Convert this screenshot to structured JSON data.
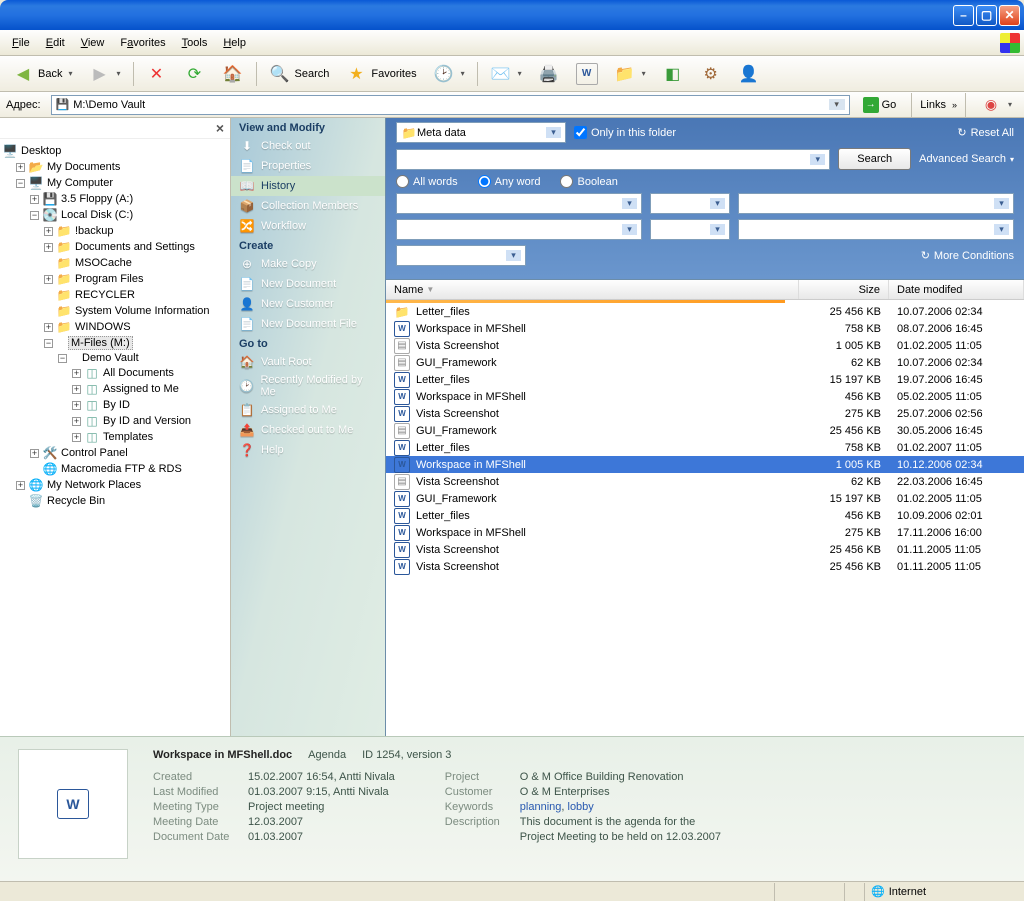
{
  "window": {
    "title_blank": ""
  },
  "menu": {
    "file": "File",
    "edit": "Edit",
    "view": "View",
    "favorites": "Favorites",
    "tools": "Tools",
    "help": "Help"
  },
  "toolbar": {
    "back": "Back",
    "search": "Search",
    "favorites": "Favorites"
  },
  "address": {
    "label": "Адрес:",
    "path": "M:\\Demo Vault",
    "go": "Go",
    "links": "Links"
  },
  "tree": {
    "desktop": "Desktop",
    "my_documents": "My Documents",
    "my_computer": "My Computer",
    "floppy": "3.5 Floppy (A:)",
    "local_disk": "Local Disk (C:)",
    "backup": "!backup",
    "docs_settings": "Documents and Settings",
    "msocache": "MSOCache",
    "program_files": "Program Files",
    "recycler": "RECYCLER",
    "svi": "System Volume Information",
    "windows": "WINDOWS",
    "mfiles": "M-Files (M:)",
    "demo_vault": "Demo Vault",
    "all_docs": "All Documents",
    "assigned": "Assigned to Me",
    "by_id": "By ID",
    "by_id_ver": "By ID and Version",
    "templates": "Templates",
    "control_panel": "Control Panel",
    "macromedia": "Macromedia FTP & RDS",
    "network_places": "My Network Places",
    "recycle_bin": "Recycle Bin"
  },
  "task": {
    "view_modify": "View and Modify",
    "check_out": "Check out",
    "properties": "Properties",
    "history": "History",
    "collection": "Collection Members",
    "workflow": "Workflow",
    "create": "Create",
    "make_copy": "Make Copy",
    "new_doc": "New Document",
    "new_cust": "New Customer",
    "new_doc_file": "New Document File",
    "go_to": "Go to",
    "vault_root": "Vault Root",
    "recently_mod": "Recently Modified by Me",
    "assigned_me": "Assigned to Me",
    "checked_out": "Checked out to Me",
    "help": "Help"
  },
  "search": {
    "meta_data": "Meta data",
    "only_folder": "Only in this folder",
    "reset_all": "Reset All",
    "search_btn": "Search",
    "advanced": "Advanced Search",
    "all_words": "All words",
    "any_word": "Any word",
    "boolean": "Boolean",
    "word_mode": "any",
    "more_conditions": "More Conditions"
  },
  "columns": {
    "name": "Name",
    "size": "Size",
    "date": "Date modifed"
  },
  "files": [
    {
      "icon": "fold",
      "name": "Letter_files",
      "size": "25 456 KB",
      "date": "10.07.2006 02:34"
    },
    {
      "icon": "word",
      "name": "Workspace in MFShell",
      "size": "758 KB",
      "date": "08.07.2006 16:45"
    },
    {
      "icon": "gen",
      "name": "Vista Screenshot",
      "size": "1 005 KB",
      "date": "01.02.2005 11:05"
    },
    {
      "icon": "gen",
      "name": "GUI_Framework",
      "size": "62 KB",
      "date": "10.07.2006 02:34"
    },
    {
      "icon": "word",
      "name": "Letter_files",
      "size": "15 197 KB",
      "date": "19.07.2006 16:45"
    },
    {
      "icon": "word",
      "name": "Workspace in MFShell",
      "size": "456 KB",
      "date": "05.02.2005 11:05"
    },
    {
      "icon": "word",
      "name": "Vista Screenshot",
      "size": "275 KB",
      "date": "25.07.2006 02:56"
    },
    {
      "icon": "gen",
      "name": "GUI_Framework",
      "size": "25 456 KB",
      "date": "30.05.2006 16:45"
    },
    {
      "icon": "word",
      "name": "Letter_files",
      "size": "758 KB",
      "date": "01.02.2007 11:05"
    },
    {
      "icon": "word",
      "name": "Workspace in MFShell",
      "size": "1 005 KB",
      "date": "10.12.2006 02:34",
      "sel": true
    },
    {
      "icon": "gen",
      "name": "Vista Screenshot",
      "size": "62 KB",
      "date": "22.03.2006 16:45"
    },
    {
      "icon": "word",
      "name": "GUI_Framework",
      "size": "15 197 KB",
      "date": "01.02.2005 11:05"
    },
    {
      "icon": "word",
      "name": "Letter_files",
      "size": "456 KB",
      "date": "10.09.2006 02:01"
    },
    {
      "icon": "word",
      "name": "Workspace in MFShell",
      "size": "275 KB",
      "date": "17.11.2006 16:00"
    },
    {
      "icon": "word",
      "name": "Vista Screenshot",
      "size": "25 456 KB",
      "date": "01.11.2005 11:05"
    },
    {
      "icon": "word",
      "name": "Vista Screenshot",
      "size": "25 456 KB",
      "date": "01.11.2005 11:05"
    }
  ],
  "detail": {
    "title": "Workspace in MFShell.doc",
    "class": "Agenda",
    "id_ver": "ID 1254, version 3",
    "created_k": "Created",
    "created_v": "15.02.2007 16:54, Antti Nivala",
    "modified_k": "Last Modified",
    "modified_v": "01.03.2007 9:15, Antti Nivala",
    "mtype_k": "Meeting Type",
    "mtype_v": "Project meeting",
    "mdate_k": "Meeting Date",
    "mdate_v": "12.03.2007",
    "ddate_k": "Document Date",
    "ddate_v": "01.03.2007",
    "project_k": "Project",
    "project_v": "O & M Office Building Renovation",
    "customer_k": "Customer",
    "customer_v": "O & M Enterprises",
    "keywords_k": "Keywords",
    "kw1": "planning",
    "kw2": "lobby",
    "desc_k": "Description",
    "desc_v1": "This document is the agenda for the",
    "desc_v2": "Project Meeting to be held on 12.03.2007"
  },
  "status": {
    "internet": "Internet"
  }
}
